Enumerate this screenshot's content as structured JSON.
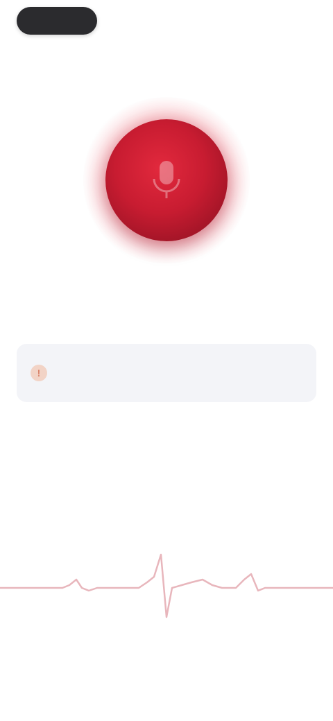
{
  "header": {
    "pill_label": "",
    "right_link": "",
    "title": ""
  },
  "record": {
    "icon": "microphone-icon"
  },
  "info_card": {
    "icon": "info-icon",
    "text": ""
  },
  "waveform": {
    "icon": "heartbeat-waveform"
  },
  "colors": {
    "accent": "#c81c31",
    "card_bg": "#f3f4f8",
    "pill_bg": "#2b2b2e",
    "ecg_line": "#e8b6bc"
  }
}
